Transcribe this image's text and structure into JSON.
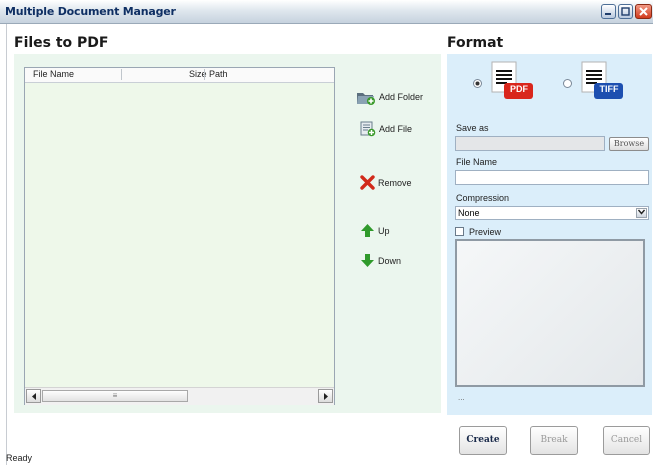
{
  "window": {
    "title": "Multiple Document Manager"
  },
  "files_section": {
    "title": "Files to PDF"
  },
  "table": {
    "columns": [
      "File Name",
      "Size",
      "Path"
    ],
    "rows": [],
    "scroll_thumb": "≡"
  },
  "actions": {
    "add_folder": "Add Folder",
    "add_file": "Add File",
    "remove": "Remove",
    "up": "Up",
    "down": "Down"
  },
  "format_section": {
    "title": "Format",
    "options": [
      {
        "label": "PDF",
        "selected": true,
        "color": "#d9261c"
      },
      {
        "label": "TIFF",
        "selected": false,
        "color": "#1d4fb0"
      }
    ],
    "save_as_label": "Save as",
    "save_as_value": "",
    "browse_label": "Browse",
    "file_name_label": "File Name",
    "file_name_value": "",
    "compression_label": "Compression",
    "compression_value": "None",
    "preview_label": "Preview",
    "preview_checked": false,
    "page_indicator": "..."
  },
  "buttons": {
    "create": "Create",
    "break": "Break",
    "cancel": "Cancel"
  },
  "status": {
    "text": "Ready"
  }
}
